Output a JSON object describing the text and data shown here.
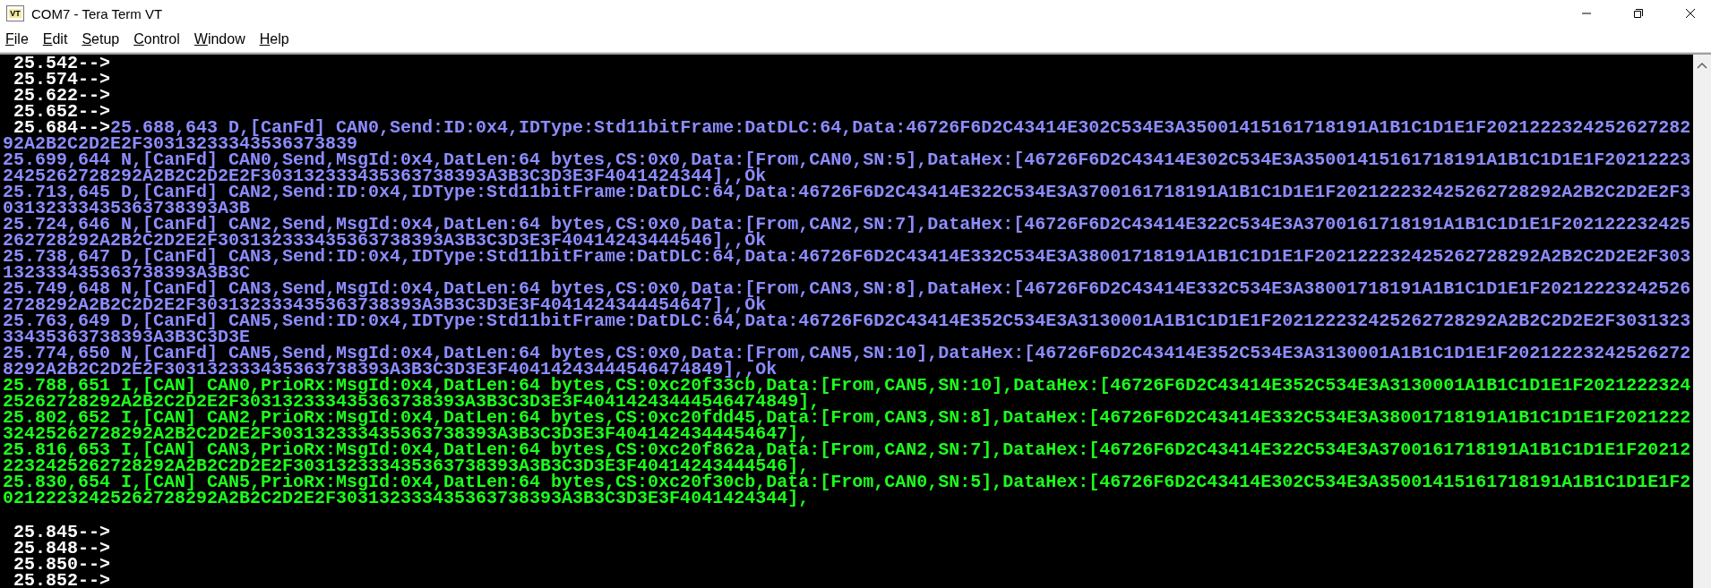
{
  "window": {
    "title": "COM7 - Tera Term VT",
    "icon_text": "VT"
  },
  "menu": [
    "File",
    "Edit",
    "Setup",
    "Control",
    "Window",
    "Help"
  ],
  "terminal": {
    "lines": [
      {
        "prompt": " 25.542-->"
      },
      {
        "prompt": " 25.574-->"
      },
      {
        "prompt": " 25.622-->"
      },
      {
        "prompt": " 25.652-->"
      },
      {
        "prompt": " 25.684-->",
        "kind": "send",
        "text": "25.688,643 D,[CanFd] CAN0,Send:ID:0x4,IDType:Std11bitFrame:DatDLC:64,Data:46726F6D2C43414E302C534E3A35001415161718191A1B1C1D1E1F2021222324252627282"
      },
      {
        "kind": "send",
        "text": "92A2B2C2D2E2F30313233343536373839"
      },
      {
        "kind": "send",
        "text": "25.699,644 N,[CanFd] CAN0,Send,MsgId:0x4,DatLen:64 bytes,CS:0x0,Data:[From,CAN0,SN:5],DataHex:[46726F6D2C43414E302C534E3A35001415161718191A1B1C1D1E1F20212223"
      },
      {
        "kind": "send",
        "text": "2425262728292A2B2C2D2E2F303132333435363738393A3B3C3D3E3F4041424344],,Ok"
      },
      {
        "kind": "send",
        "text": "25.713,645 D,[CanFd] CAN2,Send:ID:0x4,IDType:Std11bitFrame:DatDLC:64,Data:46726F6D2C43414E322C534E3A3700161718191A1B1C1D1E1F202122232425262728292A2B2C2D2E2F3"
      },
      {
        "kind": "send",
        "text": "03132333435363738393A3B"
      },
      {
        "kind": "send",
        "text": "25.724,646 N,[CanFd] CAN2,Send,MsgId:0x4,DatLen:64 bytes,CS:0x0,Data:[From,CAN2,SN:7],DataHex:[46726F6D2C43414E322C534E3A3700161718191A1B1C1D1E1F202122232425"
      },
      {
        "kind": "send",
        "text": "262728292A2B2C2D2E2F303132333435363738393A3B3C3D3E3F40414243444546],,Ok"
      },
      {
        "kind": "send",
        "text": "25.738,647 D,[CanFd] CAN3,Send:ID:0x4,IDType:Std11bitFrame:DatDLC:64,Data:46726F6D2C43414E332C534E3A38001718191A1B1C1D1E1F202122232425262728292A2B2C2D2E2F303"
      },
      {
        "kind": "send",
        "text": "132333435363738393A3B3C"
      },
      {
        "kind": "send",
        "text": "25.749,648 N,[CanFd] CAN3,Send,MsgId:0x4,DatLen:64 bytes,CS:0x0,Data:[From,CAN3,SN:8],DataHex:[46726F6D2C43414E332C534E3A38001718191A1B1C1D1E1F20212223242526"
      },
      {
        "kind": "send",
        "text": "2728292A2B2C2D2E2F303132333435363738393A3B3C3D3E3F4041424344454647],,Ok"
      },
      {
        "kind": "send",
        "text": "25.763,649 D,[CanFd] CAN5,Send:ID:0x4,IDType:Std11bitFrame:DatDLC:64,Data:46726F6D2C43414E352C534E3A3130001A1B1C1D1E1F202122232425262728292A2B2C2D2E2F3031323"
      },
      {
        "kind": "send",
        "text": "33435363738393A3B3C3D3E"
      },
      {
        "kind": "send",
        "text": "25.774,650 N,[CanFd] CAN5,Send,MsgId:0x4,DatLen:64 bytes,CS:0x0,Data:[From,CAN5,SN:10],DataHex:[46726F6D2C43414E352C534E3A3130001A1B1C1D1E1F20212223242526272"
      },
      {
        "kind": "send",
        "text": "8292A2B2C2D2E2F303132333435363738393A3B3C3D3E3F40414243444546474849],,Ok"
      },
      {
        "kind": "recv",
        "text": "25.788,651 I,[CAN] CAN0,PrioRx:MsgId:0x4,DatLen:64 bytes,CS:0xc20f33cb,Data:[From,CAN5,SN:10],DataHex:[46726F6D2C43414E352C534E3A3130001A1B1C1D1E1F2021222324"
      },
      {
        "kind": "recv",
        "text": "25262728292A2B2C2D2E2F303132333435363738393A3B3C3D3E3F40414243444546474849],"
      },
      {
        "kind": "recv",
        "text": "25.802,652 I,[CAN] CAN2,PrioRx:MsgId:0x4,DatLen:64 bytes,CS:0xc20fdd45,Data:[From,CAN3,SN:8],DataHex:[46726F6D2C43414E332C534E3A38001718191A1B1C1D1E1F2021222"
      },
      {
        "kind": "recv",
        "text": "32425262728292A2B2C2D2E2F303132333435363738393A3B3C3D3E3F4041424344454647],"
      },
      {
        "kind": "recv",
        "text": "25.816,653 I,[CAN] CAN3,PrioRx:MsgId:0x4,DatLen:64 bytes,CS:0xc20f862a,Data:[From,CAN2,SN:7],DataHex:[46726F6D2C43414E322C534E3A3700161718191A1B1C1D1E1F20212"
      },
      {
        "kind": "recv",
        "text": "2232425262728292A2B2C2D2E2F303132333435363738393A3B3C3D3E3F40414243444546],"
      },
      {
        "kind": "recv",
        "text": "25.830,654 I,[CAN] CAN5,PrioRx:MsgId:0x4,DatLen:64 bytes,CS:0xc20f30cb,Data:[From,CAN0,SN:5],DataHex:[46726F6D2C43414E302C534E3A35001415161718191A1B1C1D1E1F2"
      },
      {
        "kind": "recv",
        "text": "02122232425262728292A2B2C2D2E2F303132333435363738393A3B3C3D3E3F4041424344],"
      },
      {
        "kind": "blank"
      },
      {
        "prompt": " 25.845-->"
      },
      {
        "prompt": " 25.848-->"
      },
      {
        "prompt": " 25.850-->"
      },
      {
        "prompt": " 25.852-->"
      }
    ]
  }
}
